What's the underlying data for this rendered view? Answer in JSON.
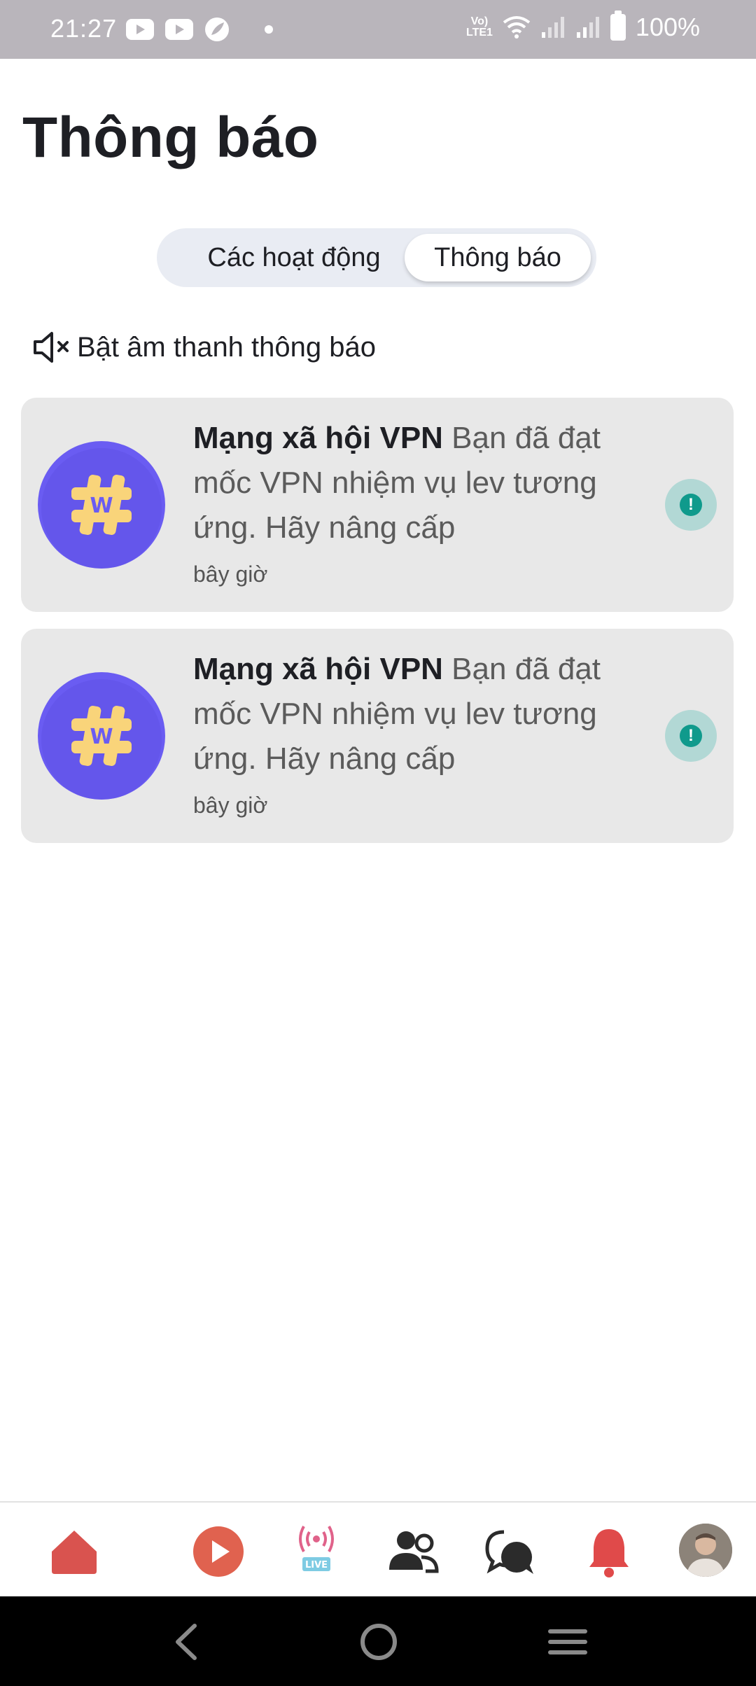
{
  "status_bar": {
    "time": "21:27",
    "volte_line1": "Vo)",
    "volte_line2": "LTE1",
    "battery": "100%"
  },
  "header": {
    "title": "Thông báo"
  },
  "tabs": [
    {
      "label": "Các hoạt động",
      "selected": false
    },
    {
      "label": "Thông báo",
      "selected": true
    }
  ],
  "sound_toggle": {
    "label": "Bật âm thanh thông báo",
    "icon": "speaker-muted-icon"
  },
  "notifications": [
    {
      "sender": "Mạng xã hội VPN",
      "message": " Bạn đã đạt mốc VPN nhiệm vụ lev tương ứng. Hãy nâng cấp",
      "time": "bây giờ",
      "avatar_letter": "W",
      "status_icon": "exclamation-icon"
    },
    {
      "sender": "Mạng xã hội VPN",
      "message": " Bạn đã đạt mốc VPN nhiệm vụ lev tương ứng. Hãy nâng cấp",
      "time": "bây giờ",
      "avatar_letter": "W",
      "status_icon": "exclamation-icon"
    }
  ],
  "bottom_nav": {
    "live_badge": "LIVE",
    "items": [
      "home-icon",
      "play-icon",
      "live-icon",
      "friends-icon",
      "chat-icon",
      "bell-icon",
      "profile-avatar"
    ]
  },
  "colors": {
    "status_bar": "#b9b5bb",
    "accent_red": "#d9534f",
    "logo_purple": "#6a5cf2",
    "logo_yellow": "#f9d47a",
    "badge_teal": "#0f9a8c",
    "card_bg": "#e8e8e8"
  }
}
